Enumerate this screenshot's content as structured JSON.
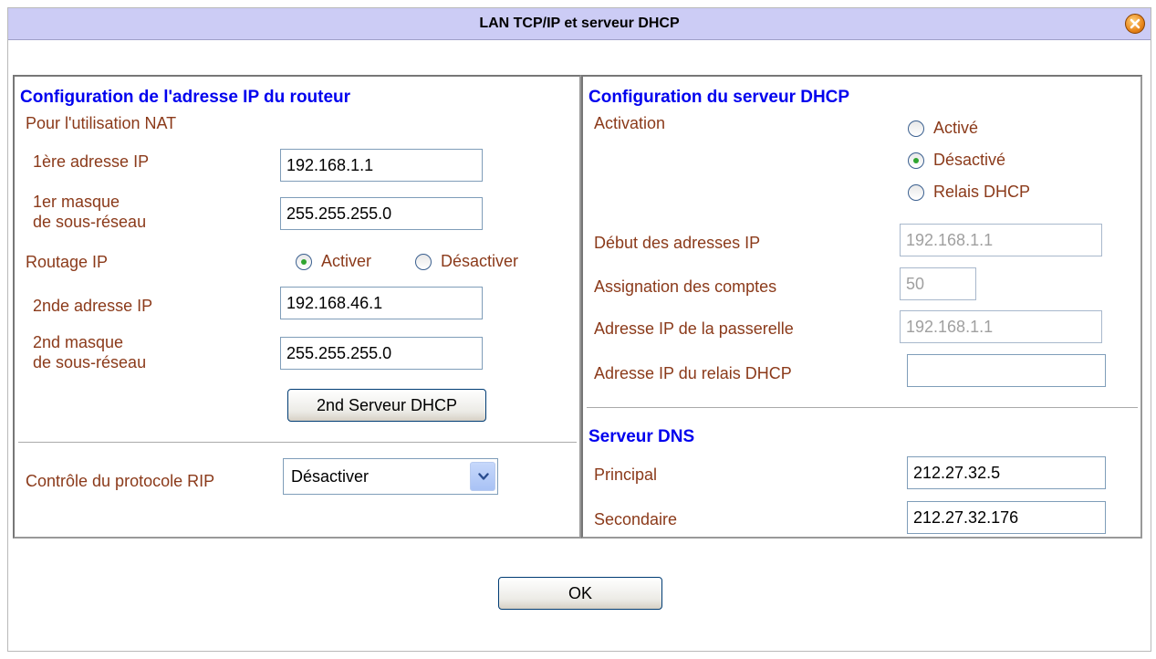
{
  "window": {
    "title": "LAN TCP/IP et serveur DHCP"
  },
  "router": {
    "title": "Configuration de l'adresse IP du routeur",
    "nat_label": "Pour l'utilisation NAT",
    "ip1_label": "1ère adresse IP",
    "ip1_value": "192.168.1.1",
    "mask1_label_line1": "1er masque",
    "mask1_label_line2": "de sous-réseau",
    "mask1_value": "255.255.255.0",
    "routing_label": "Routage IP",
    "routing_on_label": "Activer",
    "routing_off_label": "Désactiver",
    "ip2_label": "2nde adresse IP",
    "ip2_value": "192.168.46.1",
    "mask2_label_line1": "2nd masque",
    "mask2_label_line2": "de sous-réseau",
    "mask2_value": "255.255.255.0",
    "dhcp2_button": "2nd Serveur DHCP",
    "rip_label": "Contrôle du protocole RIP",
    "rip_value": "Désactiver"
  },
  "dhcp": {
    "title": "Configuration du serveur DHCP",
    "activation_label": "Activation",
    "opt_active": "Activé",
    "opt_inactive": "Désactivé",
    "opt_relay": "Relais DHCP",
    "start_label": "Début des adresses IP",
    "start_value": "192.168.1.1",
    "count_label": "Assignation des comptes",
    "count_value": "50",
    "gateway_label": "Adresse IP de la passerelle",
    "gateway_value": "192.168.1.1",
    "relay_label": "Adresse IP du relais DHCP",
    "relay_value": ""
  },
  "dns": {
    "title": "Serveur DNS",
    "primary_label": "Principal",
    "primary_value": "212.27.32.5",
    "secondary_label": "Secondaire",
    "secondary_value": "212.27.32.176"
  },
  "footer": {
    "ok_label": "OK"
  },
  "colors": {
    "title_bar": "#ccccf5",
    "section_title": "#0000ee",
    "label": "#8b3a1a"
  }
}
